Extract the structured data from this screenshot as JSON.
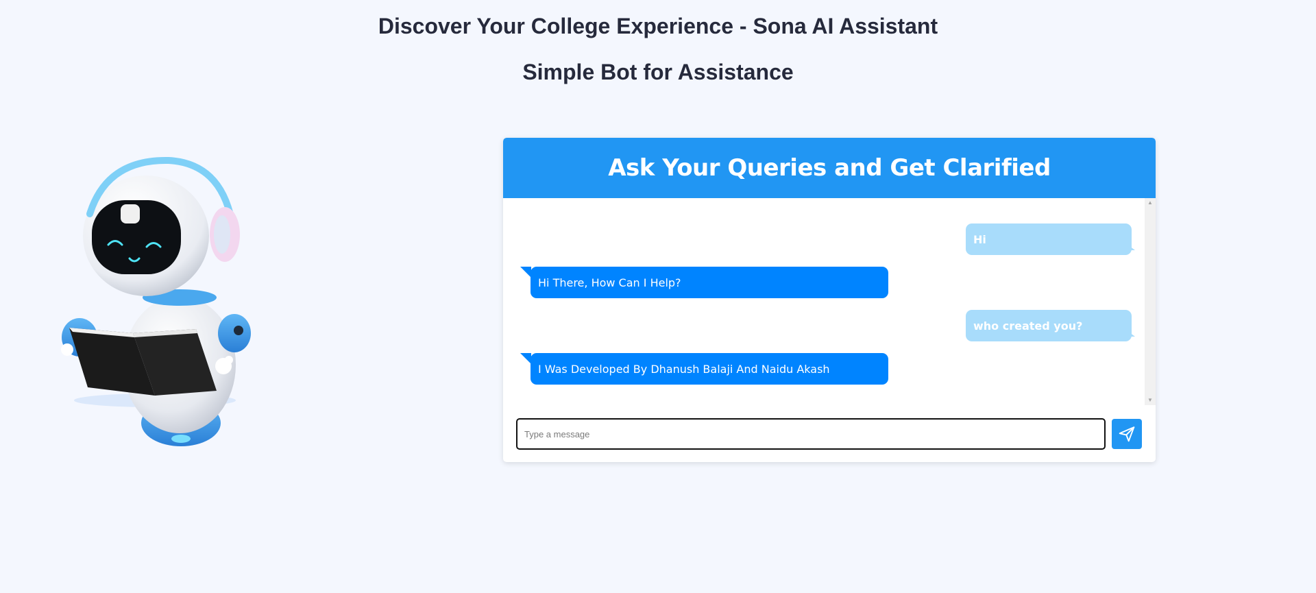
{
  "page": {
    "title": "Discover Your College Experience - Sona AI Assistant",
    "subtitle": "Simple Bot for Assistance"
  },
  "chat": {
    "header_title": "Ask Your Queries and Get Clarified",
    "messages": [
      {
        "sender": "user",
        "text": "Hi"
      },
      {
        "sender": "bot",
        "text": "Hi There, How Can I Help?"
      },
      {
        "sender": "user",
        "text": "who created you?"
      },
      {
        "sender": "bot",
        "text": "I Was Developed By Dhanush Balaji And Naidu Akash"
      }
    ],
    "input": {
      "value": "",
      "placeholder": "Type a message"
    },
    "send_icon": "send-icon"
  },
  "colors": {
    "background": "#f4f7fe",
    "header": "#2196f3",
    "user_bubble": "#a8dcfb",
    "bot_bubble": "#0084ff",
    "send_button": "#2196f3"
  },
  "illustration": "robot-reading-book"
}
